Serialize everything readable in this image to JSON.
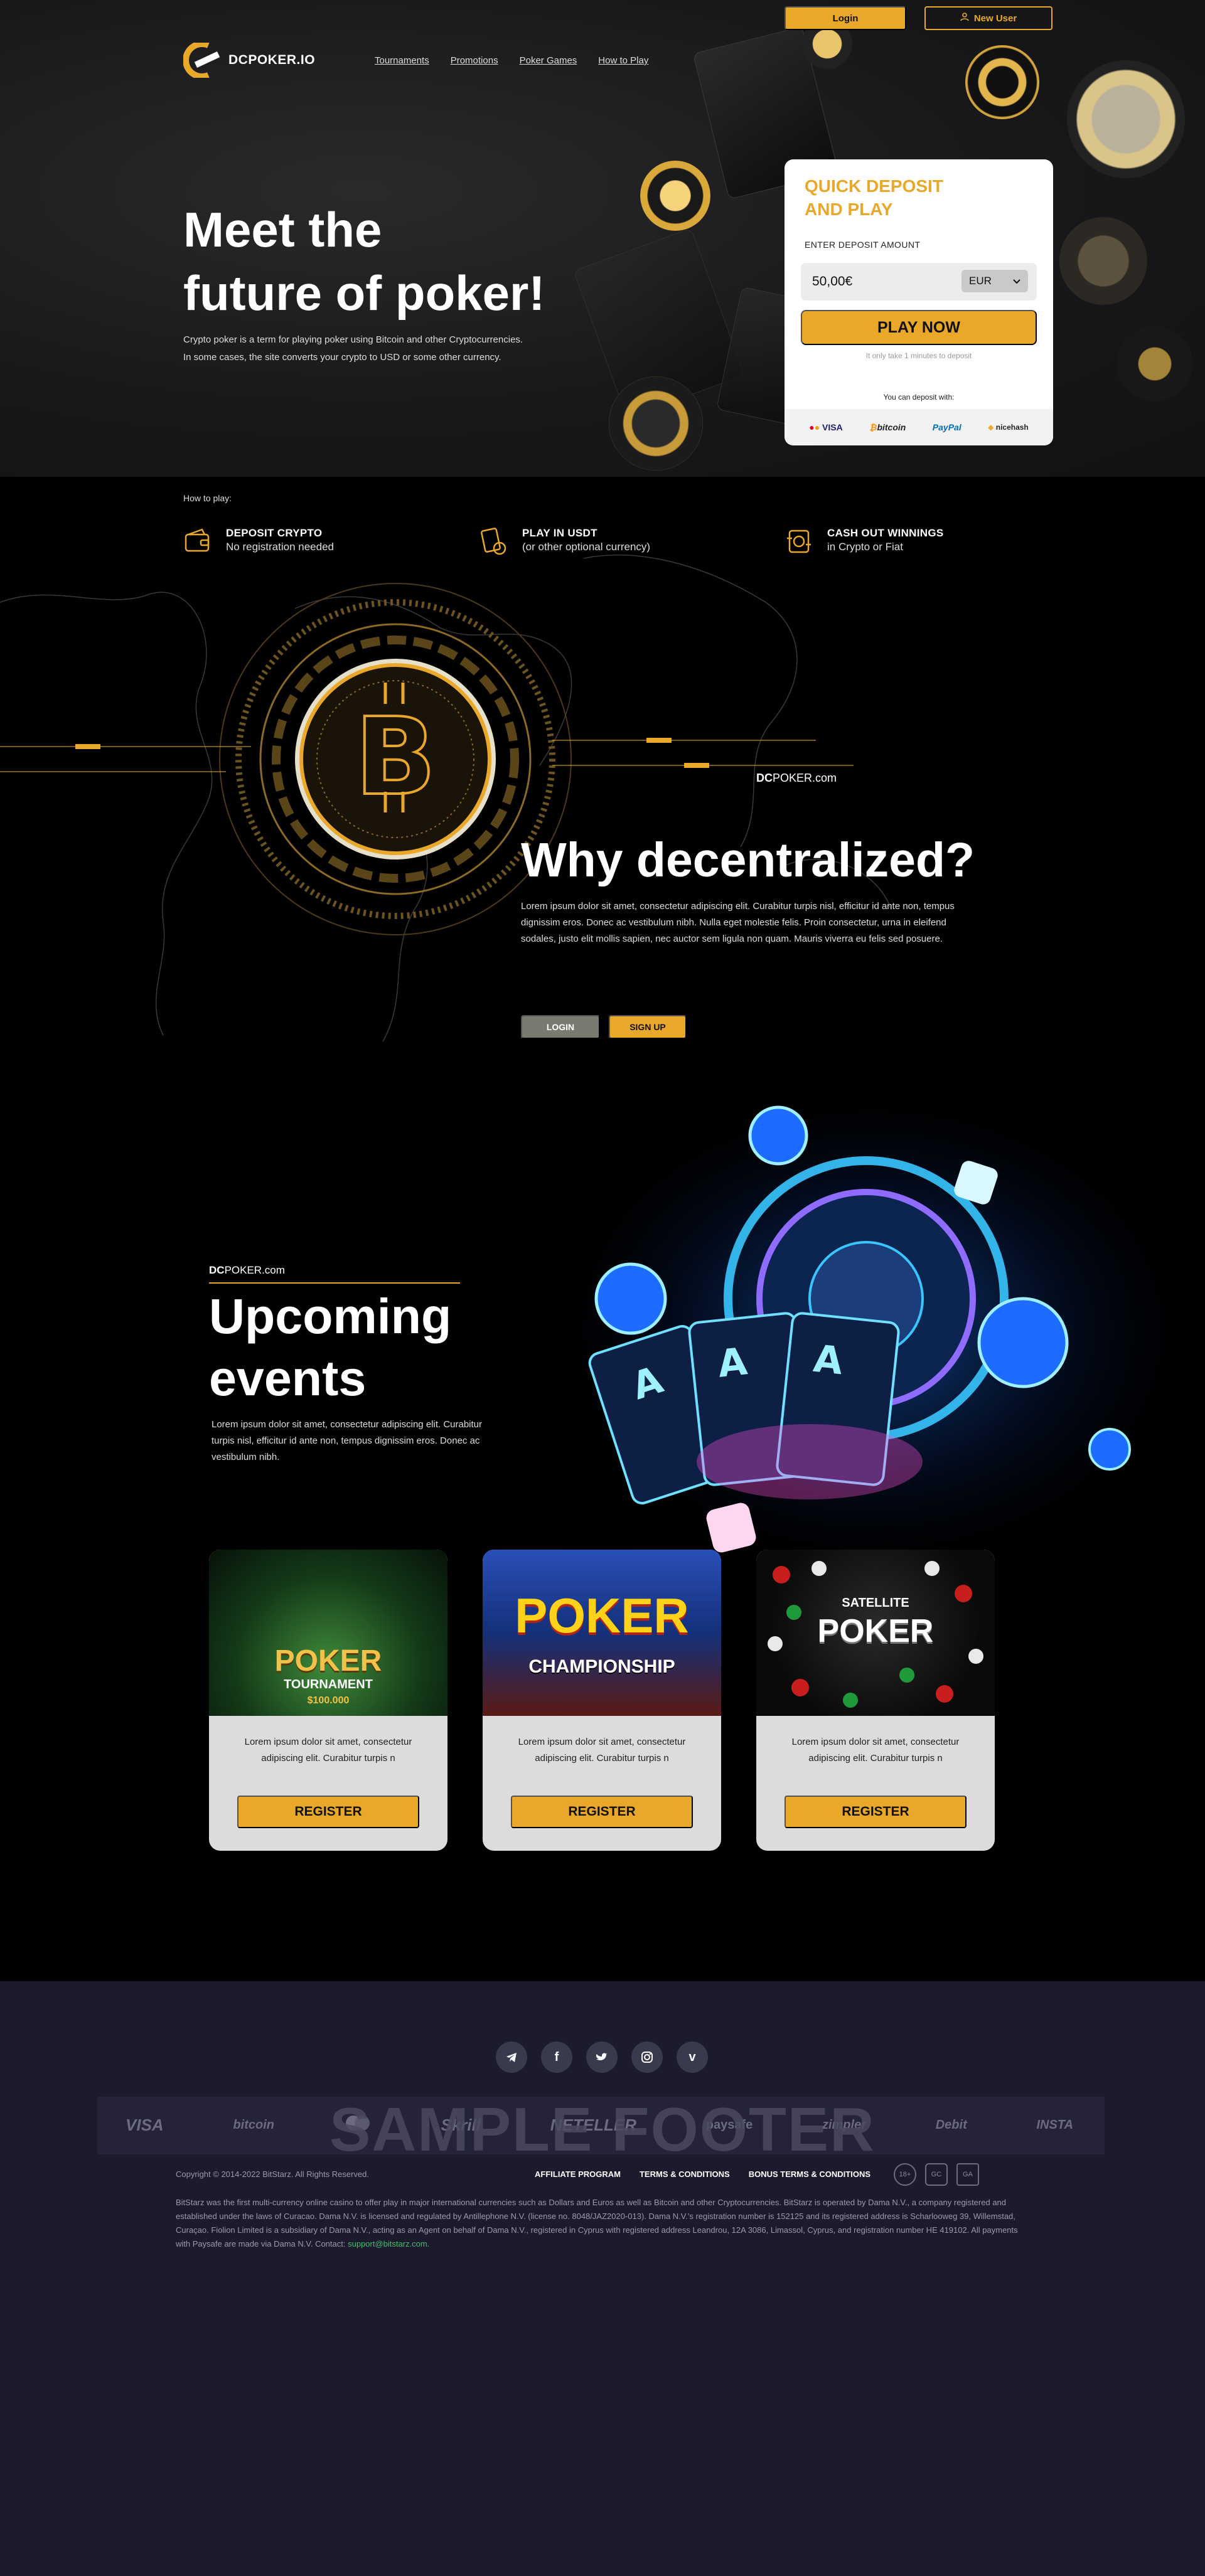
{
  "colors": {
    "accent": "#e9a829",
    "hero_bg": "#18181a",
    "footer_bg": "#1c1b2d"
  },
  "topbar": {
    "login_label": "Login",
    "new_user_label": "New User"
  },
  "brand": {
    "name_bold": "DC",
    "name_rest": "POKER.IO"
  },
  "nav": {
    "items": [
      "Tournaments",
      "Promotions",
      "Poker Games",
      "How to Play"
    ]
  },
  "hero": {
    "title_line1": "Meet the",
    "title_line2": "future of poker!",
    "desc_line1": "Crypto poker is a term for playing poker using Bitcoin and other Cryptocurrencies.",
    "desc_line2": "In some cases, the site converts your crypto to USD or some other currency."
  },
  "deposit": {
    "title": "QUICK DEPOSIT AND PLAY",
    "amount_label": "ENTER DEPOSIT AMOUNT",
    "amount_value": "50,00€",
    "currency": "EUR",
    "play_label": "PLAY NOW",
    "note": "It only take 1 minutes to deposit",
    "can_deposit_label": "You can deposit with:",
    "methods": [
      "VISA",
      "bitcoin",
      "PayPal",
      "nicehash"
    ]
  },
  "how": {
    "label": "How to play:",
    "steps": [
      {
        "title": "DEPOSIT CRYPTO",
        "sub": "No registration needed",
        "icon": "wallet-icon"
      },
      {
        "title": "PLAY IN USDT",
        "sub": "(or other optional currency)",
        "icon": "cards-icon"
      },
      {
        "title": "CASH OUT WINNINGS",
        "sub": "in Crypto or Fiat",
        "icon": "cashout-icon"
      }
    ]
  },
  "why": {
    "brand_bold": "DC",
    "brand_rest": "POKER.com",
    "title": "Why decentralized?",
    "desc": "Lorem ipsum dolor sit amet, consectetur adipiscing elit. Curabitur turpis nisl, efficitur id ante non, tempus dignissim eros. Donec ac vestibulum nibh. Nulla eget molestie felis. Proin consectetur, urna in eleifend sodales, justo elit mollis sapien, nec auctor sem ligula non quam. Mauris viverra eu felis sed posuere.",
    "login_label": "LOGIN",
    "signup_label": "SIGN UP"
  },
  "events": {
    "brand_bold": "DC",
    "brand_rest": "POKER.com",
    "title_line1": "Upcoming",
    "title_line2": "events",
    "desc": "Lorem ipsum dolor sit amet, consectetur adipiscing elit. Curabitur turpis nisl, efficitur id ante non, tempus dignissim eros. Donec ac vestibulum nibh.",
    "cards": [
      {
        "img_title": "POKER",
        "img_sub": "TOURNAMENT",
        "img_badge": "$100.000",
        "text": "Lorem ipsum dolor sit amet, consectetur adipiscing elit. Curabitur turpis n",
        "button": "REGISTER"
      },
      {
        "img_title": "POKER",
        "img_sub": "CHAMPIONSHIP",
        "img_badge": "",
        "text": "Lorem ipsum dolor sit amet, consectetur adipiscing elit. Curabitur turpis n",
        "button": "REGISTER"
      },
      {
        "img_title": "POKER",
        "img_sub": "SATELLITE",
        "img_badge": "",
        "text": "Lorem ipsum dolor sit amet, consectetur adipiscing elit. Curabitur turpis n",
        "button": "REGISTER"
      }
    ]
  },
  "footer": {
    "socials": [
      "telegram-icon",
      "facebook-icon",
      "twitter-icon",
      "instagram-icon",
      "vimeo-icon"
    ],
    "payment_logos": [
      "VISA",
      "bitcoin",
      "mastercard",
      "Skrill",
      "NETELLER",
      "paysafe",
      "zimpler",
      "Debit",
      "INSTA"
    ],
    "watermark": "SAMPLE FOOTER",
    "copyright": "Copyright © 2014-2022 BitStarz. All Rights Reserved.",
    "links": [
      "AFFILIATE PROGRAM",
      "TERMS & CONDITIONS",
      "BONUS TERMS & CONDITIONS"
    ],
    "badges": [
      "18+",
      "GC",
      "GA"
    ],
    "legal": "BitStarz was the first multi-currency online casino to offer play in major international currencies such as Dollars and Euros as well as Bitcoin and other Cryptocurrencies. BitStarz is operated by Dama N.V., a company registered and established under the laws of Curacao. Dama N.V. is licensed and regulated by Antillephone N.V. (license no. 8048/JAZ2020-013). Dama N.V.'s registration number is 152125 and its registered address is Scharlooweg 39, Willemstad, Curaçao. Fiolion Limited is a subsidiary of Dama N.V., acting as an Agent on behalf of Dama N.V., registered in Cyprus with registered address Leandrou, 12A 3086, Limassol, Cyprus, and registration number HE 419102. All payments with Paysafe are made via Dama N.V. Contact:",
    "contact_email": "support@bitstarz.com."
  }
}
